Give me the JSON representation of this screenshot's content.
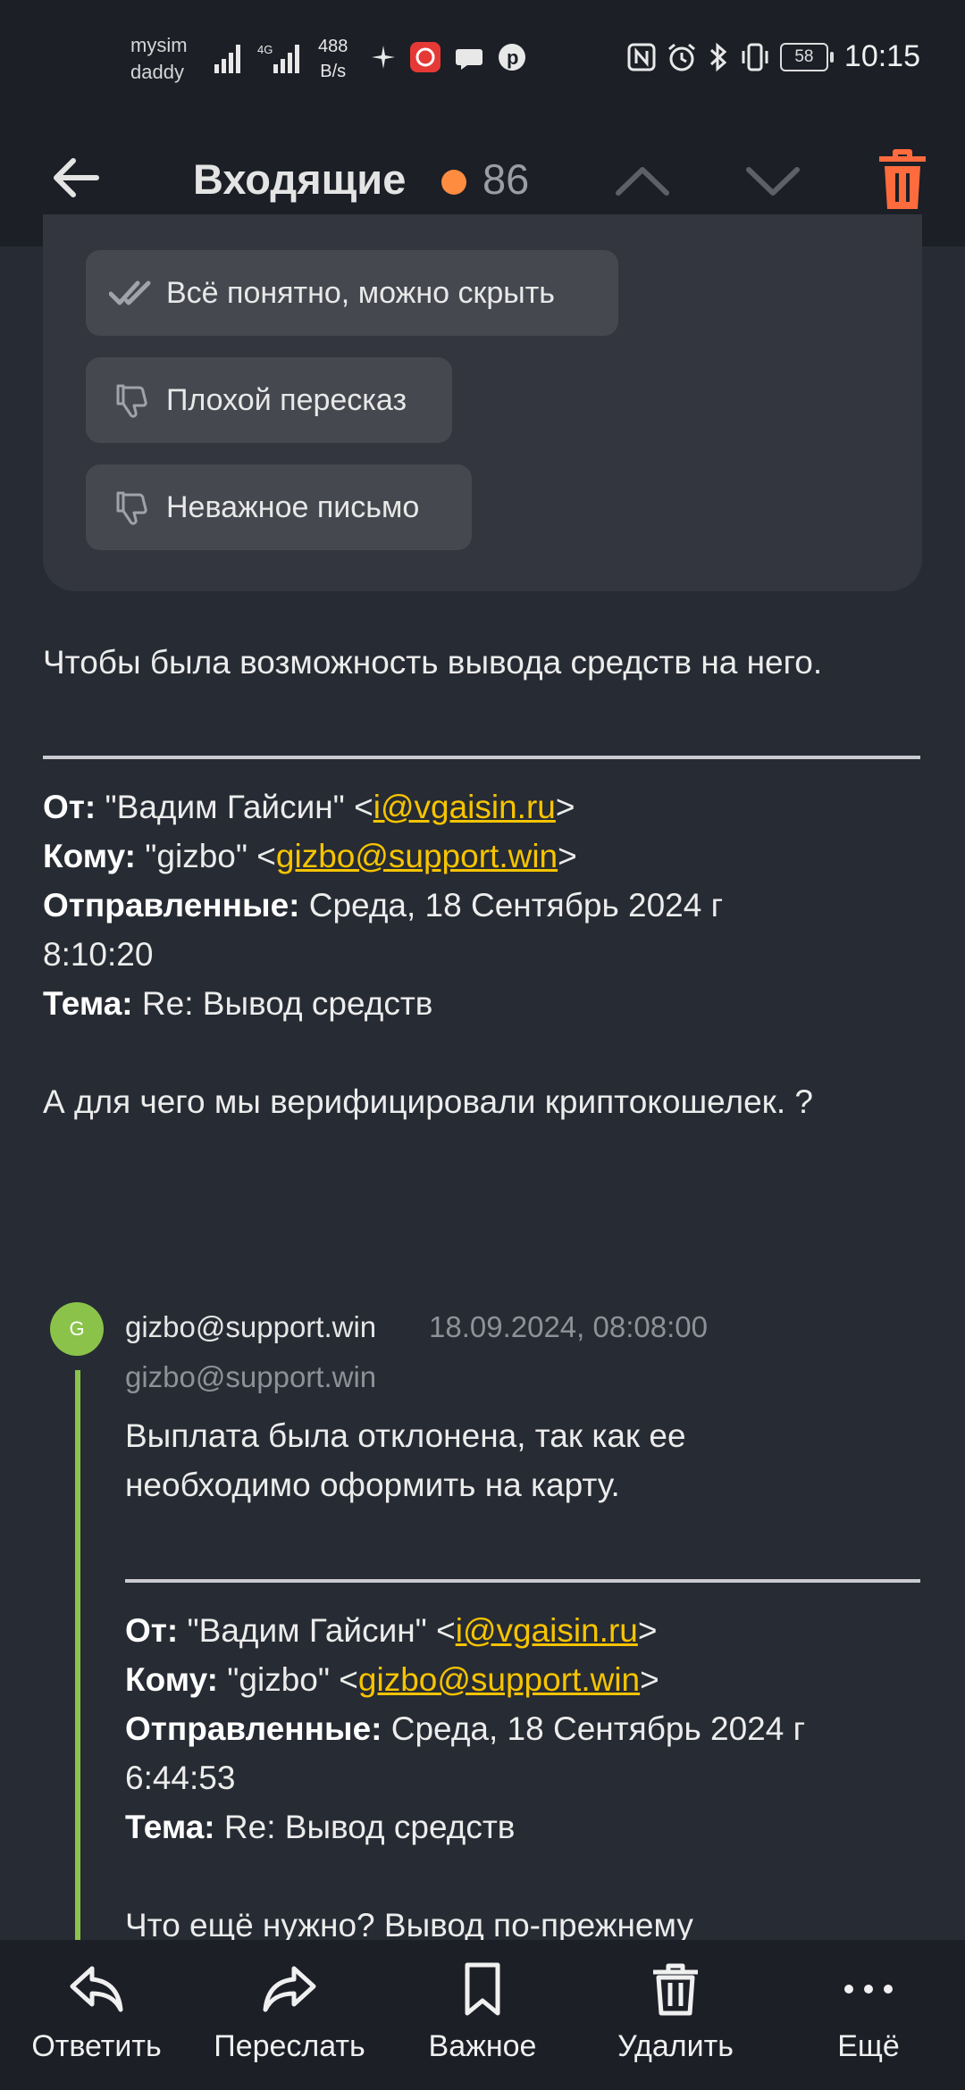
{
  "status_bar": {
    "carrier_line1": "mysim",
    "carrier_line2": "daddy",
    "speed_value": "488",
    "speed_unit": "B/s",
    "battery": "58",
    "time": "10:15"
  },
  "header": {
    "title": "Входящие",
    "unread_count": "86",
    "unread_dot_color": "#ff8c3f",
    "delete_color": "#ff6b3d"
  },
  "feedback_chips": [
    {
      "label": "Всё понятно, можно скрыть",
      "icon": "double-check-icon"
    },
    {
      "label": "Плохой пересказ",
      "icon": "thumbs-down-icon"
    },
    {
      "label": "Неважное письмо",
      "icon": "thumbs-down-icon"
    }
  ],
  "message": {
    "intro_line": "Чтобы была возможность вывода средств на него.",
    "quoted_header_1": {
      "from_label": "От:",
      "from_name": " \"Вадим Гайсин\" <",
      "from_email": "i@vgaisin.ru",
      "from_close": ">",
      "to_label": "Кому:",
      "to_name": " \"gizbo\" <",
      "to_email": "gizbo@support.win",
      "to_close": ">",
      "sent_label": "Отправленные:",
      "sent_value": " Среда, 18 Сентябрь 2024 г",
      "sent_time": "8:10:20",
      "subject_label": "Тема:",
      "subject_value": " Re: Вывод средств"
    },
    "reply_text": "А для чего мы верифицировали криптокошелек. ?"
  },
  "thread_item": {
    "avatar_letter": "G",
    "avatar_color": "#8bc34a",
    "sender": "gizbo@support.win",
    "date": "18.09.2024, 08:08:00",
    "sender_sub": "gizbo@support.win",
    "body_line1": "Выплата была отклонена, так как ее",
    "body_line2": "необходимо оформить на карту.",
    "quoted_header": {
      "from_label": "От:",
      "from_name": " \"Вадим Гайсин\" <",
      "from_email": "i@vgaisin.ru",
      "from_close": ">",
      "to_label": "Кому:",
      "to_name": " \"gizbo\" <",
      "to_email": "gizbo@support.win",
      "to_close": ">",
      "sent_label": "Отправленные:",
      "sent_value": " Среда, 18 Сентябрь 2024 г",
      "sent_time": "6:44:53",
      "subject_label": "Тема:",
      "subject_value": " Re: Вывод средств"
    },
    "cut_line": "Что ещё нужно? Вывод по-прежнему"
  },
  "bottom_bar": [
    {
      "label": "Ответить",
      "icon": "reply-icon"
    },
    {
      "label": "Переслать",
      "icon": "forward-icon"
    },
    {
      "label": "Важное",
      "icon": "bookmark-icon"
    },
    {
      "label": "Удалить",
      "icon": "trash-icon"
    },
    {
      "label": "Ещё",
      "icon": "more-dots-icon"
    }
  ]
}
